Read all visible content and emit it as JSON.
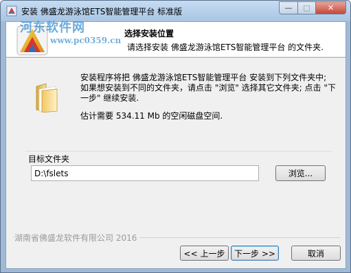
{
  "window": {
    "title": "安装 佛盛龙游泳馆ETS智能管理平台 标准版",
    "controls": {
      "minimize": "—",
      "maximize": "□",
      "close": "✕"
    }
  },
  "watermark": {
    "line1": "河东软件网",
    "line2": "www.pc0359.cn"
  },
  "header": {
    "title": "选择安装位置",
    "subtitle": "请选择安装 佛盛龙游泳馆ETS智能管理平台 的文件夹."
  },
  "body": {
    "info_line1": "安装程序将把 佛盛龙游泳馆ETS智能管理平台 安装到下列文件夹中;",
    "info_line2": "如果想安装到不同的文件夹，请点击 \"浏览\" 选择其它文件夹; 点击 \"下",
    "info_line3": "一步\" 继续安装.",
    "space_required": "估计需要 534.11 Mb 的空闲磁盘空间."
  },
  "destination": {
    "label": "目标文件夹",
    "value": "D:\\fslets",
    "browse_label": "浏览..."
  },
  "footer": {
    "copyright": "湖南省佛盛龙软件有限公司 2016",
    "back_label": "<< 上一步",
    "next_label": "下一步 >>",
    "cancel_label": "取消"
  },
  "icons": [
    "app-icon",
    "installer-logo-icon",
    "folder-icon"
  ],
  "colors": {
    "title_bar": "#a9c5e3",
    "close_button": "#c6473a",
    "dialog_bg": "#f0f0f0",
    "default_button_border": "#3c7fb1"
  }
}
